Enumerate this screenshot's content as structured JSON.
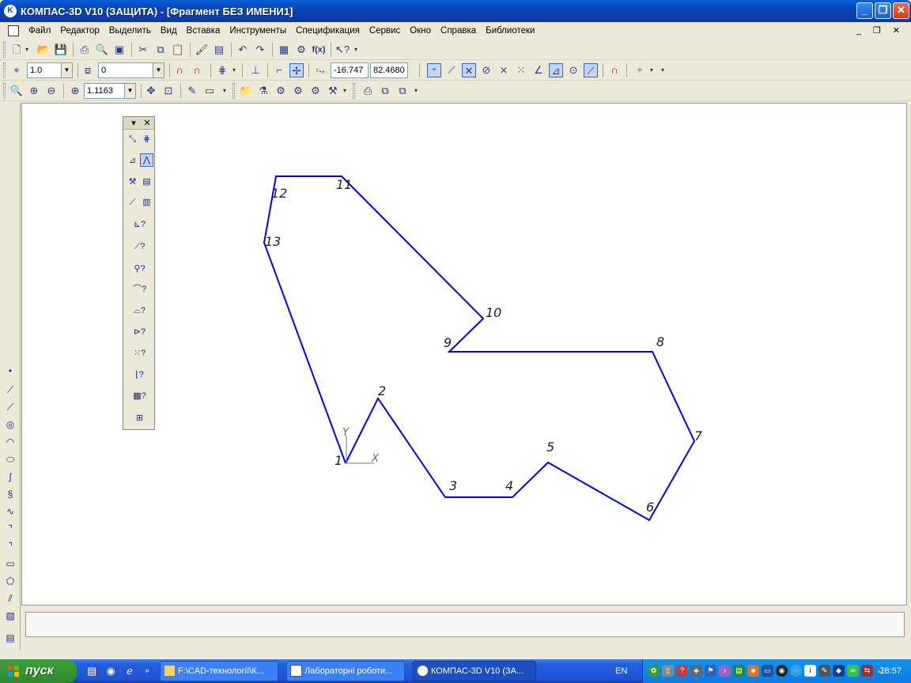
{
  "window": {
    "title": "КОМПАС-3D V10 (ЗАЩИТА) - [Фрагмент БЕЗ ИМЕНИ1]",
    "app_icon": "kompas-logo",
    "minimize": "_",
    "restore": "❐",
    "close": "✕"
  },
  "menu": {
    "items": [
      "Файл",
      "Редактор",
      "Выделить",
      "Вид",
      "Вставка",
      "Инструменты",
      "Спецификация",
      "Сервис",
      "Окно",
      "Справка",
      "Библиотеки"
    ],
    "mdi_controls": "_ ❐ ✕"
  },
  "toolbar_standard": {
    "icons": [
      "new-icon",
      "open-icon",
      "save-icon",
      "print-icon",
      "preview-icon",
      "print-setup-icon",
      "export-icon",
      "cut-icon",
      "copy-icon",
      "paste-icon",
      "format-brush-icon",
      "properties-icon",
      "undo-icon",
      "redo-icon",
      "manager-icon",
      "variables-icon",
      "fx-icon",
      "help-pointer-icon"
    ],
    "fx_label": "f(x)"
  },
  "toolbar_current_state": {
    "step": "1.0",
    "layer": "0",
    "cursor_x": "-16.747",
    "cursor_y": "82.4680"
  },
  "toolbar_view": {
    "zoom": "1.1163"
  },
  "drawing": {
    "color": "#0000ff",
    "points": [
      {
        "label": "1"
      },
      {
        "label": "2"
      },
      {
        "label": "3"
      },
      {
        "label": "4"
      },
      {
        "label": "5"
      },
      {
        "label": "6"
      },
      {
        "label": "7"
      },
      {
        "label": "8"
      },
      {
        "label": "9"
      },
      {
        "label": "10"
      },
      {
        "label": "11"
      },
      {
        "label": "12"
      },
      {
        "label": "13"
      }
    ],
    "axis_x": "X",
    "axis_y": "Y"
  },
  "taskbar": {
    "start": "пуск",
    "tasks": [
      {
        "label": "F:\\CAD-технології\\К..."
      },
      {
        "label": "Лабораторні роботи..."
      },
      {
        "label": "КОМПАС-3D V10 (ЗА..."
      }
    ],
    "lang": "EN",
    "clock": "18:57"
  }
}
